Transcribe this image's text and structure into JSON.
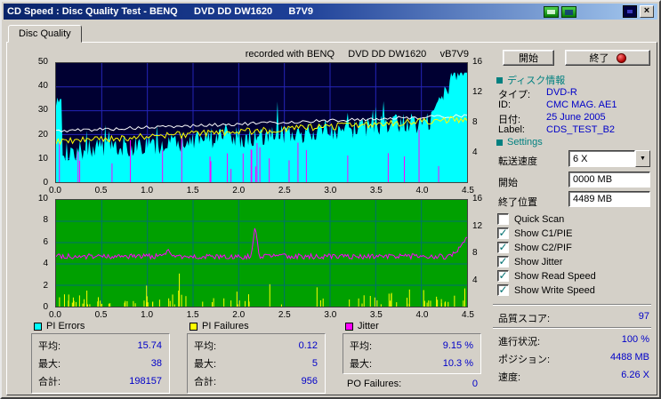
{
  "window": {
    "title": "CD Speed : Disc Quality Test - BENQ      DVD DD DW1620      B7V9"
  },
  "tab": {
    "label": "Disc Quality"
  },
  "chart_header": "recorded with BENQ     DVD DD DW1620     vB7V9",
  "glyphs": {
    "close": "×",
    "dropdown": "▼",
    "check": "✓"
  },
  "chart_data": [
    {
      "type": "area",
      "title": "PI Errors / speed (top graph)",
      "x_range": [
        0,
        4.5
      ],
      "xticks": [
        "0.0",
        "0.5",
        "1.0",
        "1.5",
        "2.0",
        "2.5",
        "3.0",
        "3.5",
        "4.0",
        "4.5"
      ],
      "ylim": [
        0,
        50
      ],
      "yticks_left": [
        "50",
        "40",
        "30",
        "20",
        "10",
        "0"
      ],
      "yticks_right": [
        "16",
        "12",
        "8",
        "4"
      ],
      "bg": "#000032",
      "grid": "#2525b8",
      "series": [
        {
          "name": "PI Errors",
          "color": "#00ffff",
          "style": "area",
          "average": 15.74,
          "maximum": 38,
          "total": 198157
        },
        {
          "name": "PIF spikes",
          "color": "#ff00ff",
          "style": "spikes"
        },
        {
          "name": "Read Speed",
          "color": "#ffffff",
          "style": "line"
        },
        {
          "name": "Write Speed",
          "color": "#ffff00",
          "style": "line"
        }
      ]
    },
    {
      "type": "line",
      "title": "Jitter / PI Failures (bottom graph)",
      "x_range": [
        0,
        4.5
      ],
      "xticks": [
        "0.0",
        "0.5",
        "1.0",
        "1.5",
        "2.0",
        "2.5",
        "3.0",
        "3.5",
        "4.0",
        "4.5"
      ],
      "ylim": [
        0,
        10
      ],
      "yticks_left": [
        "10",
        "8",
        "6",
        "4",
        "2",
        "0"
      ],
      "yticks_right": [
        "16",
        "12",
        "8",
        "4"
      ],
      "bg": "#00a000",
      "grid": "#007070",
      "series": [
        {
          "name": "Jitter",
          "color": "#ff00ff",
          "style": "line",
          "average_pct": 9.15,
          "maximum_pct": 10.3,
          "plot_level": 4.7,
          "plot_peak": 7.3
        },
        {
          "name": "PI Failures",
          "color": "#ffff00",
          "style": "spikes",
          "average": 0.12,
          "maximum": 5,
          "total": 956
        }
      ]
    }
  ],
  "legend": {
    "pi_errors": {
      "title": "PI Errors",
      "swatch": "#00ffff",
      "rows": [
        [
          "平均:",
          "15.74"
        ],
        [
          "最大:",
          "38"
        ],
        [
          "合計:",
          "198157"
        ]
      ]
    },
    "pi_failures": {
      "title": "PI Failures",
      "swatch": "#ffff00",
      "rows": [
        [
          "平均:",
          "0.12"
        ],
        [
          "最大:",
          "5"
        ],
        [
          "合計:",
          "956"
        ]
      ]
    },
    "jitter": {
      "title": "Jitter",
      "swatch": "#ff00ff",
      "rows": [
        [
          "平均:",
          "9.15 %"
        ],
        [
          "最大:",
          "10.3 %"
        ]
      ]
    },
    "po_failures": {
      "label": "PO Failures:",
      "value": "0"
    }
  },
  "side": {
    "start_button": "開始",
    "exit_button": "終了",
    "disc_info": {
      "header": "ディスク情報",
      "rows": [
        [
          "タイプ:",
          "DVD-R"
        ],
        [
          "ID:",
          "CMC MAG. AE1"
        ],
        [
          "日付:",
          "25 June 2005"
        ],
        [
          "Label:",
          "CDS_TEST_B2"
        ]
      ]
    },
    "settings": {
      "header": "Settings",
      "speed_label": "転送速度",
      "speed_value": "6 X",
      "start_label": "開始",
      "start_value": "0000 MB",
      "end_label": "終了位置",
      "end_value": "4489 MB",
      "checkboxes": [
        {
          "label": "Quick Scan",
          "checked": false
        },
        {
          "label": "Show C1/PIE",
          "checked": true
        },
        {
          "label": "Show C2/PIF",
          "checked": true
        },
        {
          "label": "Show Jitter",
          "checked": true
        },
        {
          "label": "Show Read Speed",
          "checked": true
        },
        {
          "label": "Show Write Speed",
          "checked": true
        }
      ]
    },
    "score": {
      "label": "品質スコア:",
      "value": "97"
    },
    "status": [
      [
        "進行状況:",
        "100 %"
      ],
      [
        "ポジション:",
        "4488 MB"
      ],
      [
        "速度:",
        "6.26 X"
      ]
    ]
  }
}
